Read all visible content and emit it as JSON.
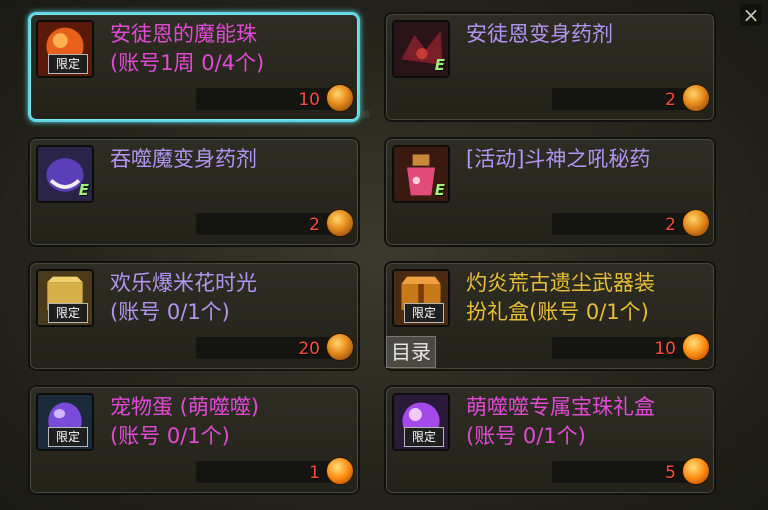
{
  "close_label": "×",
  "tooltip": "目录",
  "items": [
    {
      "name": "安徒恩的魔能珠\n(账号1周 0/4个)",
      "price": "10",
      "tag": "限定",
      "name_color": "pink",
      "coin": "gold",
      "icon": "fire-orb-icon",
      "selected": true
    },
    {
      "name": "安徒恩变身药剂",
      "price": "2",
      "tag": "E",
      "name_color": "purple",
      "coin": "gold",
      "icon": "dark-creature-icon",
      "selected": false
    },
    {
      "name": "吞噬魔变身药剂",
      "price": "2",
      "tag": "E",
      "name_color": "purple",
      "coin": "gold",
      "icon": "purple-demon-icon",
      "selected": false
    },
    {
      "name": "[活动]斗神之吼秘药",
      "price": "2",
      "tag": "E",
      "name_color": "purple",
      "coin": "gold",
      "icon": "potion-flask-icon",
      "selected": false
    },
    {
      "name": "欢乐爆米花时光\n(账号 0/1个)",
      "price": "20",
      "tag": "限定",
      "name_color": "purple",
      "coin": "gold",
      "icon": "popcorn-box-icon",
      "selected": false
    },
    {
      "name": "灼炎荒古遗尘武器装\n扮礼盒(账号 0/1个)",
      "price": "10",
      "tag": "限定",
      "name_color": "gold",
      "coin": "orange",
      "icon": "weapon-box-icon",
      "selected": false
    },
    {
      "name": "宠物蛋 (萌噬噬)\n(账号 0/1个)",
      "price": "1",
      "tag": "限定",
      "name_color": "pink",
      "coin": "orange",
      "icon": "pet-egg-icon",
      "selected": false
    },
    {
      "name": "萌噬噬专属宝珠礼盒\n(账号 0/1个)",
      "price": "5",
      "tag": "限定",
      "name_color": "pink",
      "coin": "orange",
      "icon": "purple-orb-box-icon",
      "selected": false
    }
  ]
}
